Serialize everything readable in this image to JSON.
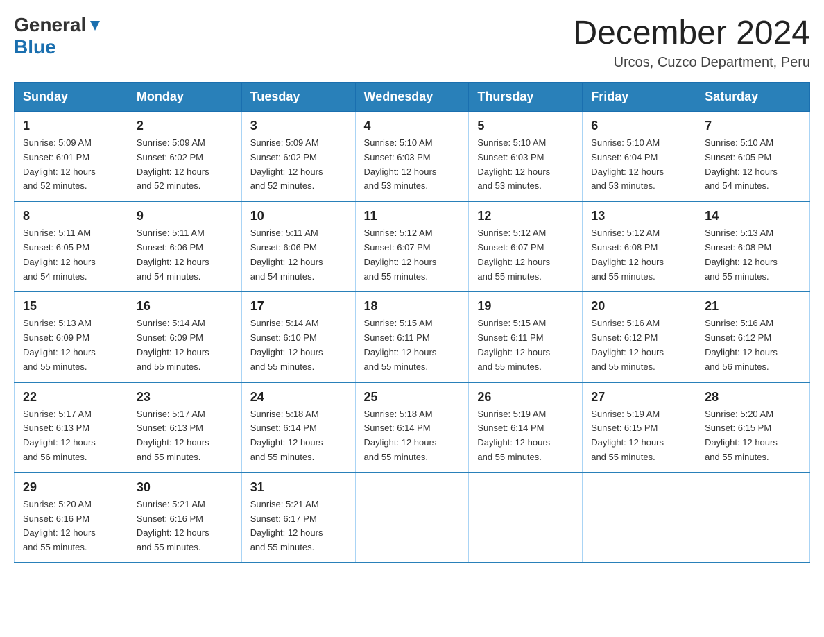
{
  "header": {
    "logo": {
      "general": "General",
      "blue": "Blue",
      "arrow": "▶"
    },
    "title": "December 2024",
    "subtitle": "Urcos, Cuzco Department, Peru"
  },
  "days_of_week": [
    "Sunday",
    "Monday",
    "Tuesday",
    "Wednesday",
    "Thursday",
    "Friday",
    "Saturday"
  ],
  "weeks": [
    [
      {
        "day": 1,
        "sunrise": "5:09 AM",
        "sunset": "6:01 PM",
        "daylight": "12 hours and 52 minutes."
      },
      {
        "day": 2,
        "sunrise": "5:09 AM",
        "sunset": "6:02 PM",
        "daylight": "12 hours and 52 minutes."
      },
      {
        "day": 3,
        "sunrise": "5:09 AM",
        "sunset": "6:02 PM",
        "daylight": "12 hours and 52 minutes."
      },
      {
        "day": 4,
        "sunrise": "5:10 AM",
        "sunset": "6:03 PM",
        "daylight": "12 hours and 53 minutes."
      },
      {
        "day": 5,
        "sunrise": "5:10 AM",
        "sunset": "6:03 PM",
        "daylight": "12 hours and 53 minutes."
      },
      {
        "day": 6,
        "sunrise": "5:10 AM",
        "sunset": "6:04 PM",
        "daylight": "12 hours and 53 minutes."
      },
      {
        "day": 7,
        "sunrise": "5:10 AM",
        "sunset": "6:05 PM",
        "daylight": "12 hours and 54 minutes."
      }
    ],
    [
      {
        "day": 8,
        "sunrise": "5:11 AM",
        "sunset": "6:05 PM",
        "daylight": "12 hours and 54 minutes."
      },
      {
        "day": 9,
        "sunrise": "5:11 AM",
        "sunset": "6:06 PM",
        "daylight": "12 hours and 54 minutes."
      },
      {
        "day": 10,
        "sunrise": "5:11 AM",
        "sunset": "6:06 PM",
        "daylight": "12 hours and 54 minutes."
      },
      {
        "day": 11,
        "sunrise": "5:12 AM",
        "sunset": "6:07 PM",
        "daylight": "12 hours and 55 minutes."
      },
      {
        "day": 12,
        "sunrise": "5:12 AM",
        "sunset": "6:07 PM",
        "daylight": "12 hours and 55 minutes."
      },
      {
        "day": 13,
        "sunrise": "5:12 AM",
        "sunset": "6:08 PM",
        "daylight": "12 hours and 55 minutes."
      },
      {
        "day": 14,
        "sunrise": "5:13 AM",
        "sunset": "6:08 PM",
        "daylight": "12 hours and 55 minutes."
      }
    ],
    [
      {
        "day": 15,
        "sunrise": "5:13 AM",
        "sunset": "6:09 PM",
        "daylight": "12 hours and 55 minutes."
      },
      {
        "day": 16,
        "sunrise": "5:14 AM",
        "sunset": "6:09 PM",
        "daylight": "12 hours and 55 minutes."
      },
      {
        "day": 17,
        "sunrise": "5:14 AM",
        "sunset": "6:10 PM",
        "daylight": "12 hours and 55 minutes."
      },
      {
        "day": 18,
        "sunrise": "5:15 AM",
        "sunset": "6:11 PM",
        "daylight": "12 hours and 55 minutes."
      },
      {
        "day": 19,
        "sunrise": "5:15 AM",
        "sunset": "6:11 PM",
        "daylight": "12 hours and 55 minutes."
      },
      {
        "day": 20,
        "sunrise": "5:16 AM",
        "sunset": "6:12 PM",
        "daylight": "12 hours and 55 minutes."
      },
      {
        "day": 21,
        "sunrise": "5:16 AM",
        "sunset": "6:12 PM",
        "daylight": "12 hours and 56 minutes."
      }
    ],
    [
      {
        "day": 22,
        "sunrise": "5:17 AM",
        "sunset": "6:13 PM",
        "daylight": "12 hours and 56 minutes."
      },
      {
        "day": 23,
        "sunrise": "5:17 AM",
        "sunset": "6:13 PM",
        "daylight": "12 hours and 55 minutes."
      },
      {
        "day": 24,
        "sunrise": "5:18 AM",
        "sunset": "6:14 PM",
        "daylight": "12 hours and 55 minutes."
      },
      {
        "day": 25,
        "sunrise": "5:18 AM",
        "sunset": "6:14 PM",
        "daylight": "12 hours and 55 minutes."
      },
      {
        "day": 26,
        "sunrise": "5:19 AM",
        "sunset": "6:14 PM",
        "daylight": "12 hours and 55 minutes."
      },
      {
        "day": 27,
        "sunrise": "5:19 AM",
        "sunset": "6:15 PM",
        "daylight": "12 hours and 55 minutes."
      },
      {
        "day": 28,
        "sunrise": "5:20 AM",
        "sunset": "6:15 PM",
        "daylight": "12 hours and 55 minutes."
      }
    ],
    [
      {
        "day": 29,
        "sunrise": "5:20 AM",
        "sunset": "6:16 PM",
        "daylight": "12 hours and 55 minutes."
      },
      {
        "day": 30,
        "sunrise": "5:21 AM",
        "sunset": "6:16 PM",
        "daylight": "12 hours and 55 minutes."
      },
      {
        "day": 31,
        "sunrise": "5:21 AM",
        "sunset": "6:17 PM",
        "daylight": "12 hours and 55 minutes."
      },
      null,
      null,
      null,
      null
    ]
  ],
  "labels": {
    "sunrise": "Sunrise:",
    "sunset": "Sunset:",
    "daylight": "Daylight:"
  }
}
